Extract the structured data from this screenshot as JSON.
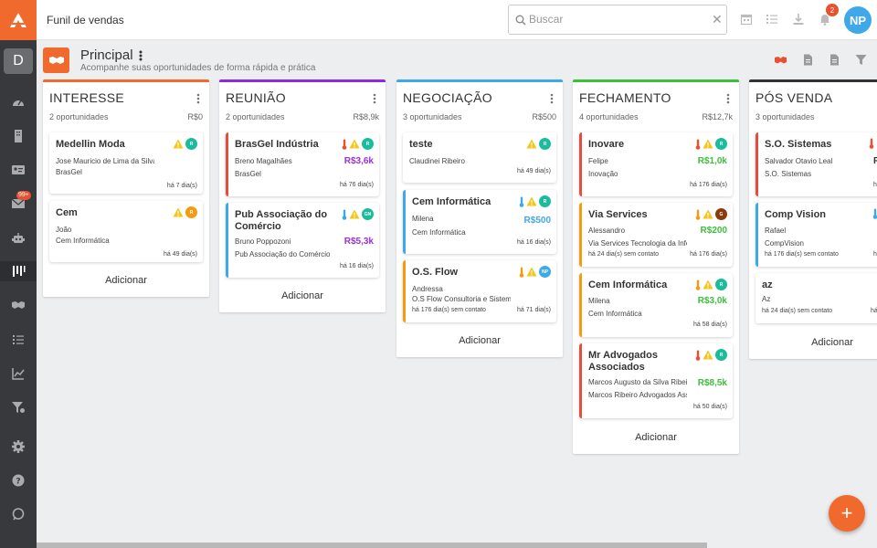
{
  "topbar": {
    "title": "Funil de vendas",
    "search_placeholder": "Buscar",
    "notif_count": "2",
    "avatar": "NP"
  },
  "sidebar": {
    "workspace": "D",
    "mail_badge": "99+"
  },
  "page": {
    "title": "Principal",
    "subtitle": "Acompanhe suas oportunidades de forma rápida e prática"
  },
  "colors": {
    "accent": "#f16a2d",
    "interesse": "#f16a2d",
    "reuniao": "#8a2be2",
    "negociacao": "#3fa8e8",
    "fechamento": "#3cc03c",
    "posvenda": "#333333",
    "green_avatar": "#1abc9c",
    "value_purple": "#9b30d9",
    "value_blue": "#3fa8e8",
    "value_green": "#3cc03c",
    "red_border": "#e74c3c",
    "orange_border": "#f39c12"
  },
  "columns": [
    {
      "title": "INTERESSE",
      "count": "2 oportunidades",
      "total": "R$0",
      "add": "Adicionar",
      "cards": [
        {
          "title": "Medellin Moda",
          "l1": "Jose Mauricio de Lima da Silva",
          "l2": "BrasGel",
          "foot": "há 7 dia(s)",
          "av": "R"
        },
        {
          "title": "Cem",
          "l1": "João",
          "l2": "Cem Informática",
          "foot": "há 49 dia(s)",
          "av": "R"
        }
      ]
    },
    {
      "title": "REUNIÃO",
      "count": "2 oportunidades",
      "total": "R$8,9k",
      "add": "Adicionar",
      "cards": [
        {
          "title": "BrasGel Indústria",
          "l1": "Breno Magalhães",
          "l2": "BrasGel",
          "value": "R$3,6k",
          "foot": "há 76 dia(s)",
          "av": "R"
        },
        {
          "title": "Pub Associação do Comércio",
          "l1": "Bruno Poppozoni",
          "l2": "Pub Associação do Comércio",
          "value": "R$5,3k",
          "foot": "há 16 dia(s)",
          "av": "GN"
        }
      ]
    },
    {
      "title": "NEGOCIAÇÃO",
      "count": "3 oportunidades",
      "total": "R$500",
      "add": "Adicionar",
      "cards": [
        {
          "title": "teste",
          "l1": "Claudinei Ribeiro",
          "foot": "há 49 dia(s)",
          "av": "R"
        },
        {
          "title": "Cem Informática",
          "l1": "Milena",
          "l2": "Cem Informática",
          "value": "R$500",
          "foot": "há 16 dia(s)",
          "av": "R"
        },
        {
          "title": "O.S. Flow",
          "l1": "Andressa",
          "l2": "O.S Flow Consultoria e Sistemas",
          "footl": "há 176 dia(s) sem contato",
          "foot": "há 71 dia(s)",
          "av": "NP"
        }
      ]
    },
    {
      "title": "FECHAMENTO",
      "count": "4 oportunidades",
      "total": "R$12,7k",
      "add": "Adicionar",
      "cards": [
        {
          "title": "Inovare",
          "l1": "Felipe",
          "l2": "Inovação",
          "value": "R$1,0k",
          "foot": "há 176 dia(s)",
          "av": "R"
        },
        {
          "title": "Via Services",
          "l1": "Alessandro",
          "l2": "Via Services Tecnologia da Informação",
          "value": "R$200",
          "footl": "há 24 dia(s) sem contato",
          "foot": "há 176 dia(s)",
          "av": "G"
        },
        {
          "title": "Cem Informática",
          "l1": "Milena",
          "l2": "Cem Informática",
          "value": "R$3,0k",
          "foot": "há 58 dia(s)",
          "av": "R"
        },
        {
          "title": "Mr Advogados Associados",
          "l1": "Marcos Augusto da Silva Ribeiro",
          "l2": "Marcos Ribeiro Advogados Associados",
          "value": "R$8,5k",
          "foot": "há 50 dia(s)",
          "av": "R"
        }
      ]
    },
    {
      "title": "PÓS VENDA",
      "count": "3 oportunidades",
      "add": "Adicionar",
      "cards": [
        {
          "title": "S.O. Sistemas",
          "l1": "Salvador Otavio Leal",
          "l2": "S.O. Sistemas",
          "value": "R",
          "foot": "há"
        },
        {
          "title": "Comp Vision",
          "l1": "Rafael",
          "l2": "CompVision",
          "value": "R",
          "footl": "há 176 dia(s) sem contato",
          "foot": "há"
        },
        {
          "title": "az",
          "l1": "Az",
          "footl": "há 24 dia(s) sem contato",
          "foot": "há"
        }
      ]
    }
  ],
  "fab": "+"
}
